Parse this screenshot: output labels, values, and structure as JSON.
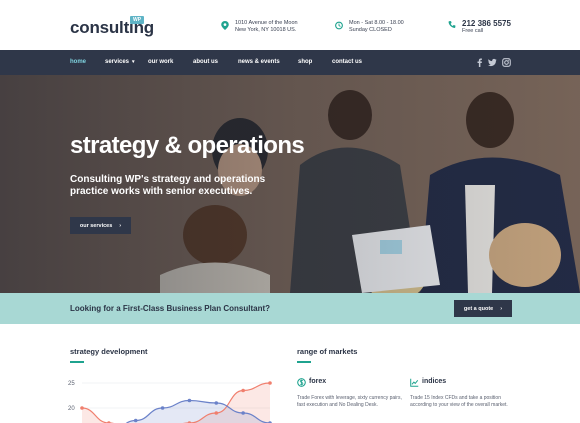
{
  "header": {
    "logo": "consulting",
    "logo_badge": "WP",
    "address": {
      "line1": "1010 Avenue of the Moon",
      "line2": "New York, NY 10018 US."
    },
    "hours": {
      "line1": "Mon - Sat 8.00 - 18.00",
      "line2": "Sunday CLOSED"
    },
    "phone": {
      "number": "212 386 5575",
      "label": "Free call"
    }
  },
  "nav": {
    "items": [
      "home",
      "services",
      "our work",
      "about us",
      "news & events",
      "shop",
      "contact us"
    ],
    "active": "home",
    "social": [
      "facebook-icon",
      "twitter-icon",
      "instagram-icon"
    ]
  },
  "hero": {
    "title": "strategy & operations",
    "subtitle": "Consulting WP's strategy and operations practice works with senior executives.",
    "button": "our services"
  },
  "cta": {
    "text": "Looking for a First-Class Business Plan Consultant?",
    "button": "get a quote"
  },
  "strategy": {
    "title": "strategy development"
  },
  "markets": {
    "title": "range of markets",
    "items": [
      {
        "icon": "money-icon",
        "title": "forex",
        "desc": "Trade Forex with leverage, sixty currency pairs, fast execution and No Dealing Desk."
      },
      {
        "icon": "trend-icon",
        "title": "indices",
        "desc": "Trade 15 Index CFDs and take a position according to your view of the overall market."
      }
    ]
  },
  "colors": {
    "navy": "#2f3749",
    "accent": "#7fd3df",
    "teal": "#1fa38f",
    "cta_bg": "#a8d8d4",
    "series_red": "#f07f6e",
    "series_blue": "#6b82c9"
  },
  "chart_data": {
    "type": "area",
    "yticks": [
      "25",
      "20"
    ],
    "ylim": [
      15,
      25
    ],
    "x": [
      1,
      2,
      3,
      4,
      5,
      6,
      7,
      8
    ],
    "series": [
      {
        "values": [
          20,
          17,
          15,
          16,
          17,
          19,
          23.5,
          25
        ]
      },
      {
        "values": [
          13,
          15,
          17.5,
          20,
          21.5,
          21,
          19,
          17
        ]
      }
    ]
  }
}
